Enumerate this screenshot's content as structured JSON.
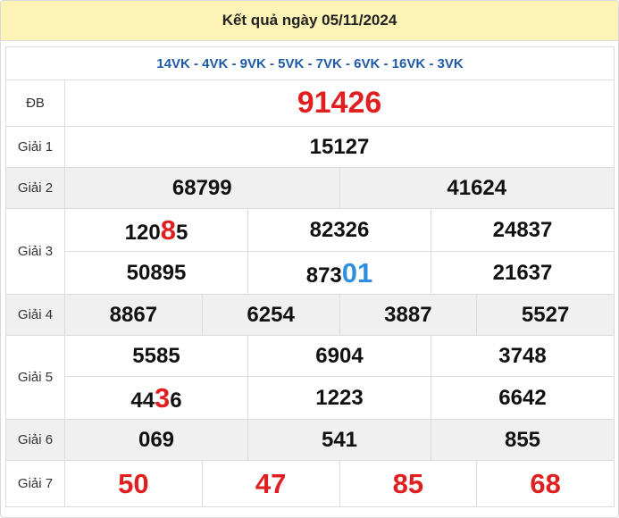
{
  "header": {
    "title": "Kết quả ngày 05/11/2024"
  },
  "codes": "14VK - 4VK - 9VK - 5VK - 7VK - 6VK - 16VK - 3VK",
  "labels": {
    "db": "ĐB",
    "g1": "Giải 1",
    "g2": "Giải 2",
    "g3": "Giải 3",
    "g4": "Giải 4",
    "g5": "Giải 5",
    "g6": "Giải 6",
    "g7": "Giải 7"
  },
  "results": {
    "db": "91426",
    "g1": "15127",
    "g2": [
      "68799",
      "41624"
    ],
    "g3": [
      {
        "pre": "120",
        "hl": "8",
        "post": "5"
      },
      {
        "pre": "82326",
        "hl": "",
        "post": ""
      },
      {
        "pre": "24837",
        "hl": "",
        "post": ""
      },
      {
        "pre": "50895",
        "hl": "",
        "post": ""
      },
      {
        "pre": "873",
        "hl": "01",
        "post": ""
      },
      {
        "pre": "21637",
        "hl": "",
        "post": ""
      }
    ],
    "g4": [
      "8867",
      "6254",
      "3887",
      "5527"
    ],
    "g5": [
      {
        "pre": "5585",
        "hl": "",
        "post": ""
      },
      {
        "pre": "6904",
        "hl": "",
        "post": ""
      },
      {
        "pre": "3748",
        "hl": "",
        "post": ""
      },
      {
        "pre": "44",
        "hl": "3",
        "post": "6"
      },
      {
        "pre": "1223",
        "hl": "",
        "post": ""
      },
      {
        "pre": "6642",
        "hl": "",
        "post": ""
      }
    ],
    "g6": [
      "069",
      "541",
      "855"
    ],
    "g7": [
      "50",
      "47",
      "85",
      "68"
    ]
  },
  "colors": {
    "accent_red": "#e02020",
    "accent_blue": "#2e8fe0",
    "code_blue": "#1f5aa6",
    "header_bg": "#fdf3b6"
  }
}
